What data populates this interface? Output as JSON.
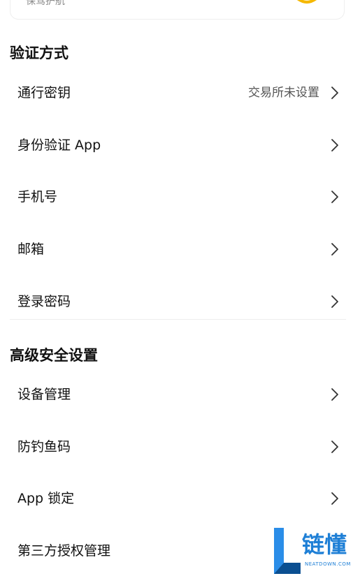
{
  "top_card": {
    "text": "保驾护航"
  },
  "sections": [
    {
      "title": "验证方式",
      "items": [
        {
          "label": "通行密钥",
          "value": "交易所未设置"
        },
        {
          "label": "身份验证 App",
          "value": ""
        },
        {
          "label": "手机号",
          "value": ""
        },
        {
          "label": "邮箱",
          "value": ""
        },
        {
          "label": "登录密码",
          "value": ""
        }
      ]
    },
    {
      "title": "高级安全设置",
      "items": [
        {
          "label": "设备管理",
          "value": ""
        },
        {
          "label": "防钓鱼码",
          "value": ""
        },
        {
          "label": "App 锁定",
          "value": ""
        },
        {
          "label": "第三方授权管理",
          "value": ""
        }
      ]
    }
  ],
  "watermark": {
    "text": "链懂",
    "subtext": "NEATDOWN.COM"
  },
  "colors": {
    "text": "#111111",
    "secondary": "#555555",
    "chevron": "#333333",
    "accent_yellow": "#f5b800",
    "watermark_blue": "#1e7fd6"
  }
}
